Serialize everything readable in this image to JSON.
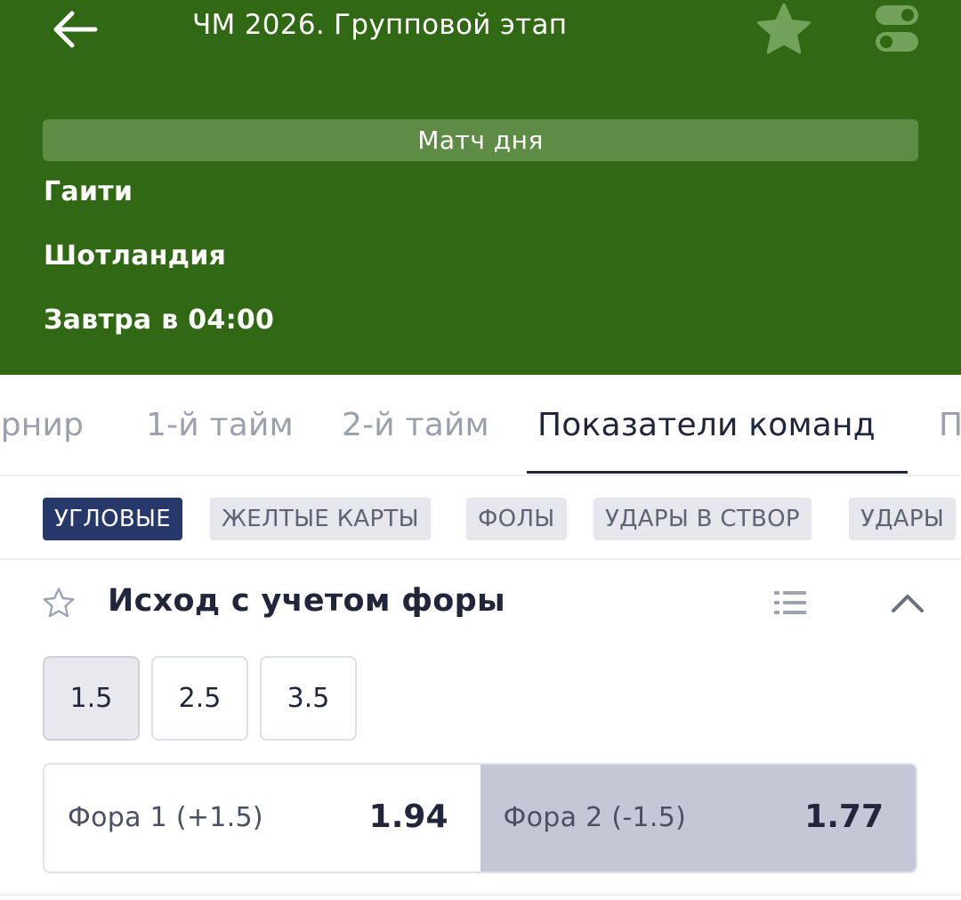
{
  "header": {
    "title": "ЧМ 2026. Групповой этап",
    "match_day_label": "Матч дня",
    "team1": "Гаити",
    "team2": "Шотландия",
    "match_time": "Завтра в 04:00",
    "bg_color": "#316814"
  },
  "tabs": [
    {
      "label": "Турнир",
      "active": false
    },
    {
      "label": "1-й тайм",
      "active": false
    },
    {
      "label": "2-й тайм",
      "active": false
    },
    {
      "label": "Показатели команд",
      "active": true
    },
    {
      "label": "П",
      "active": false
    }
  ],
  "chips": [
    {
      "label": "УГЛОВЫЕ",
      "active": true
    },
    {
      "label": "ЖЕЛТЫЕ КАРТЫ",
      "active": false
    },
    {
      "label": "ФОЛЫ",
      "active": false
    },
    {
      "label": "УДАРЫ В СТВОР",
      "active": false
    },
    {
      "label": "УДАРЫ",
      "active": false
    }
  ],
  "market": {
    "title": "Исход с учетом форы",
    "lines": [
      {
        "label": "1.5",
        "selected": true
      },
      {
        "label": "2.5",
        "selected": false
      },
      {
        "label": "3.5",
        "selected": false
      }
    ],
    "odds": [
      {
        "label": "Фора 1 (+1.5)",
        "value": "1.94"
      },
      {
        "label": "Фора 2 (-1.5)",
        "value": "1.77"
      }
    ]
  },
  "colors": {
    "accent_dark": "#27396b",
    "text_dark": "#22263a",
    "selected_odd_bg": "#c4c7d6"
  },
  "icons": [
    "back-arrow-icon",
    "star-icon",
    "toggle-settings-icon",
    "star-outline-icon",
    "list-icon",
    "chevron-up-icon"
  ]
}
